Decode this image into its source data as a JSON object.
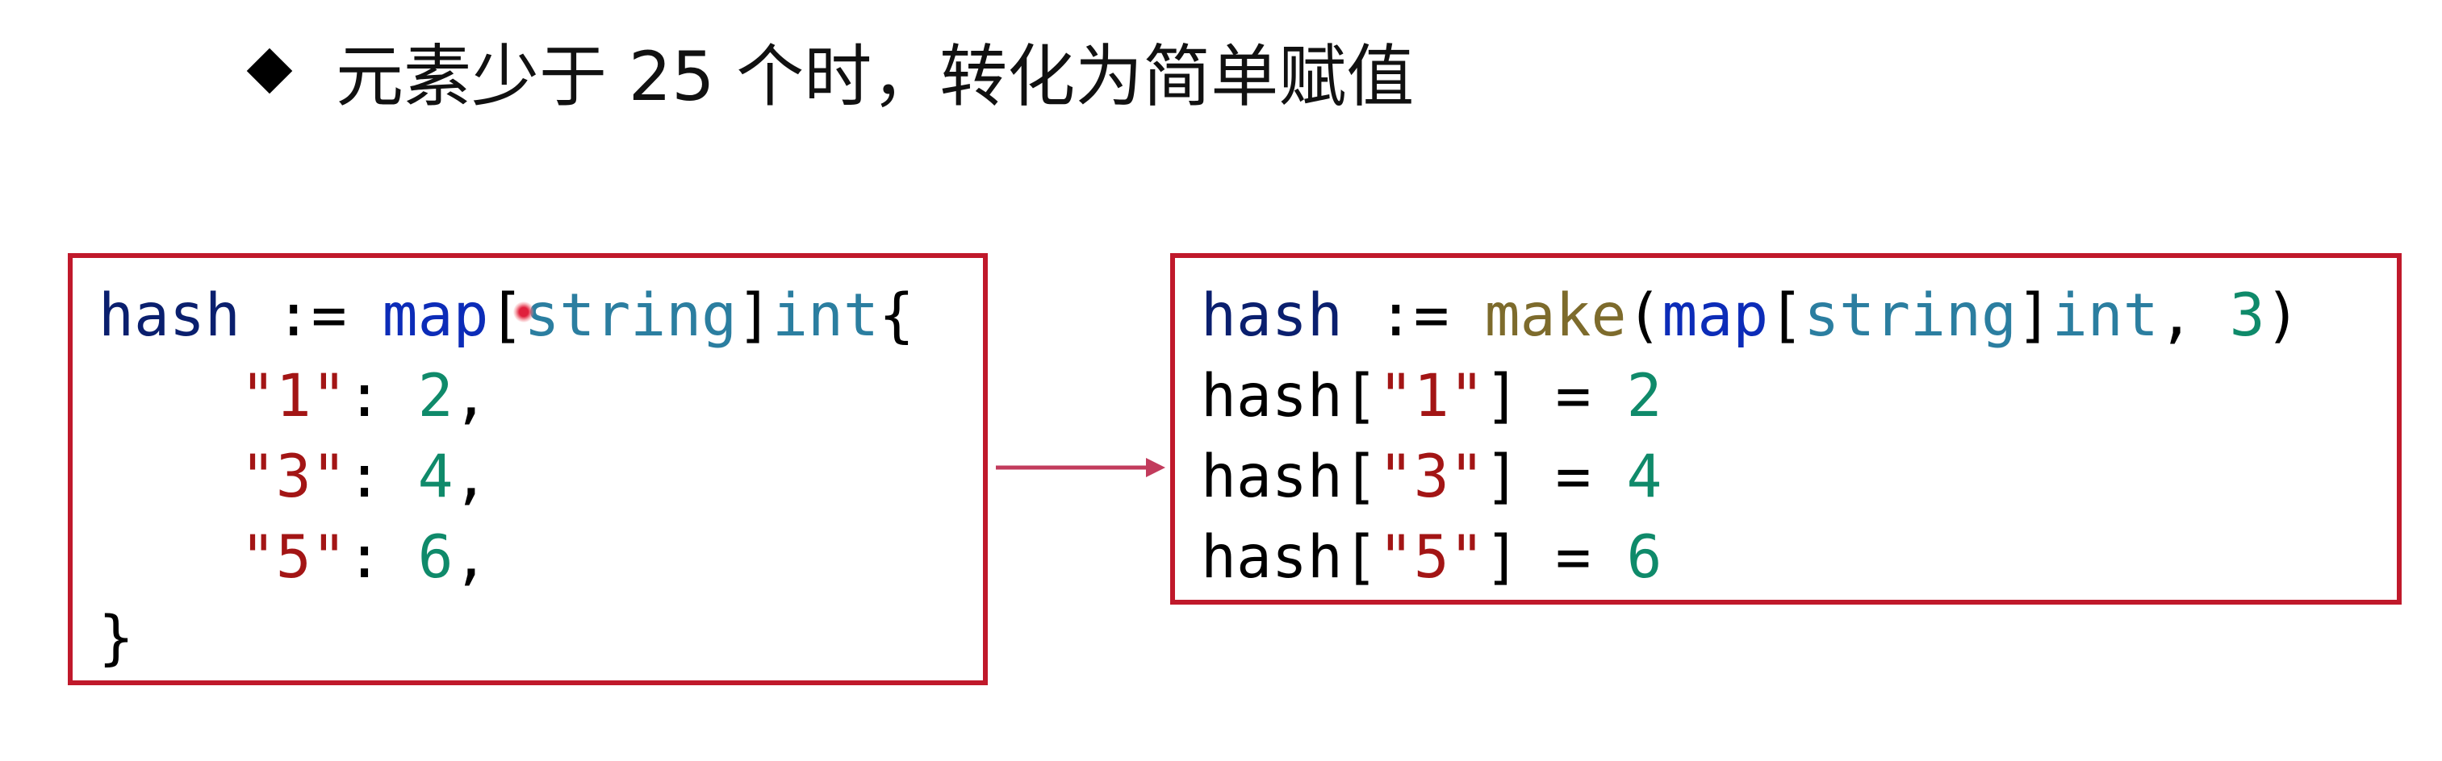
{
  "heading": {
    "text": "元素少于 25 个时，转化为简单赋值"
  },
  "left_code": {
    "l1": {
      "var": "hash",
      "op": " := ",
      "kw": "map",
      "ob": "[",
      "typ1": "string",
      "cb": "]",
      "typ2": "int",
      "brace": "{"
    },
    "l2": {
      "indent": "    ",
      "str": "\"1\"",
      "colon": ": ",
      "num": "2",
      "comma": ","
    },
    "l3": {
      "indent": "    ",
      "str": "\"3\"",
      "colon": ": ",
      "num": "4",
      "comma": ","
    },
    "l4": {
      "indent": "    ",
      "str": "\"5\"",
      "colon": ": ",
      "num": "6",
      "comma": ","
    },
    "l5": {
      "brace": "}"
    }
  },
  "right_code": {
    "l1": {
      "var": "hash",
      "op": " := ",
      "fn": "make",
      "op2": "(",
      "kw": "map",
      "ob": "[",
      "typ1": "string",
      "cb": "]",
      "typ2": "int",
      "sep": ", ",
      "num": "3",
      "cp": ")"
    },
    "l2": {
      "var": "hash",
      "ob": "[",
      "str": "\"1\"",
      "cb": "]",
      "eq": " = ",
      "num": "2"
    },
    "l3": {
      "var": "hash",
      "ob": "[",
      "str": "\"3\"",
      "cb": "]",
      "eq": " = ",
      "num": "4"
    },
    "l4": {
      "var": "hash",
      "ob": "[",
      "str": "\"5\"",
      "cb": "]",
      "eq": " = ",
      "num": "6"
    }
  },
  "colors": {
    "box_border": "#c0192b",
    "arrow": "#c23b5c",
    "keyword": "#0c2cb8",
    "type": "#2b7ea0",
    "string": "#a31515",
    "number": "#0f8a6a",
    "function": "#7d6b2c"
  },
  "icons": {
    "bullet": "diamond-bullet-icon",
    "arrow": "right-arrow-icon",
    "pointer": "laser-pointer-dot"
  }
}
